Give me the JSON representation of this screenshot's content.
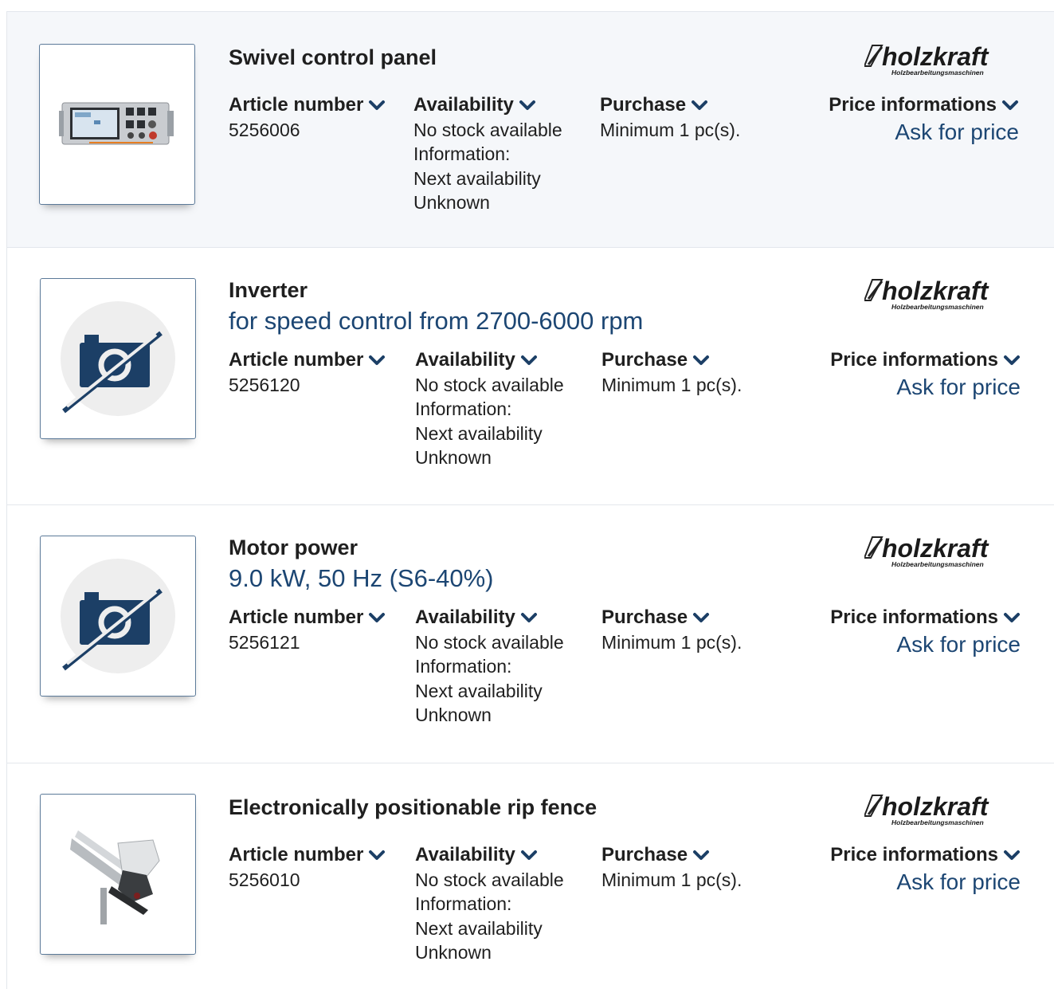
{
  "labels": {
    "article_number": "Article number",
    "availability": "Availability",
    "purchase": "Purchase",
    "price_informations": "Price informations",
    "ask_for_price": "Ask for price",
    "brand_name": "holzkraft",
    "brand_tagline": "Holzbearbeitungsmaschinen"
  },
  "colors": {
    "accent": "#1c4673",
    "chevron": "#1c3f66",
    "placeholder_bg": "#eeeeee"
  },
  "products": [
    {
      "title": "Swivel control panel",
      "subtitle": "",
      "image": "control-panel-photo",
      "article_number": "5256006",
      "availability": [
        "No stock available",
        "Information:",
        "Next availability",
        "Unknown"
      ],
      "purchase": "Minimum 1 pc(s)."
    },
    {
      "title": "Inverter",
      "subtitle": "for speed control from 2700-6000 rpm",
      "image": "no-image-placeholder",
      "article_number": "5256120",
      "availability": [
        "No stock available",
        "Information:",
        "Next availability",
        "Unknown"
      ],
      "purchase": "Minimum 1 pc(s)."
    },
    {
      "title": "Motor power",
      "subtitle": "9.0 kW, 50 Hz (S6-40%)",
      "image": "no-image-placeholder",
      "article_number": "5256121",
      "availability": [
        "No stock available",
        "Information:",
        "Next availability",
        "Unknown"
      ],
      "purchase": "Minimum 1 pc(s)."
    },
    {
      "title": "Electronically positionable rip fence",
      "subtitle": "",
      "image": "rip-fence-photo",
      "article_number": "5256010",
      "availability": [
        "No stock available",
        "Information:",
        "Next availability",
        "Unknown"
      ],
      "purchase": "Minimum 1 pc(s)."
    }
  ]
}
